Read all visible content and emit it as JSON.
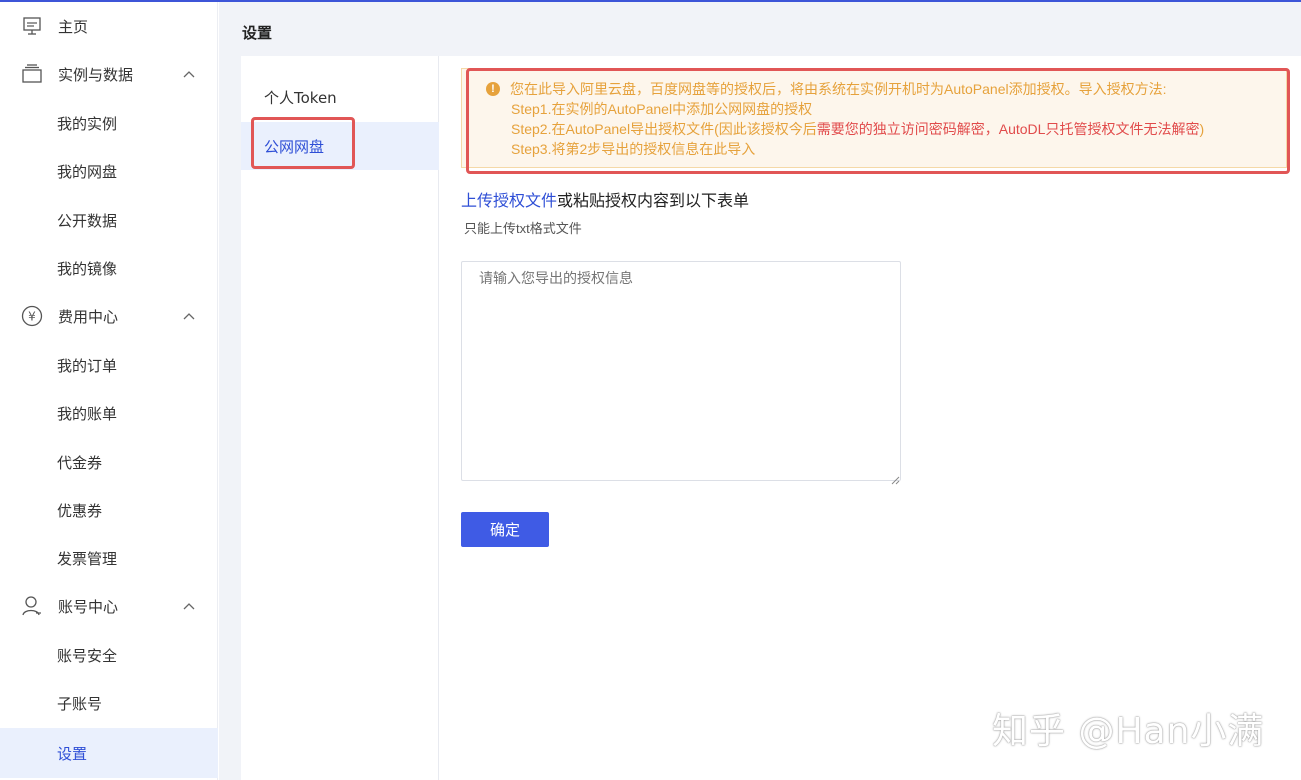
{
  "sidebar": {
    "home": "主页",
    "instances_group": "实例与数据",
    "my_instances": "我的实例",
    "my_netdisk": "我的网盘",
    "public_data": "公开数据",
    "my_images": "我的镜像",
    "billing_group": "费用中心",
    "my_orders": "我的订单",
    "my_bills": "我的账单",
    "vouchers": "代金券",
    "coupons": "优惠券",
    "invoices": "发票管理",
    "account_group": "账号中心",
    "account_security": "账号安全",
    "sub_accounts": "子账号",
    "settings": "设置"
  },
  "page": {
    "title": "设置"
  },
  "tabs": {
    "personal_token": "个人Token",
    "public_netdisk": "公网网盘"
  },
  "alert": {
    "line1": "您在此导入阿里云盘，百度网盘等的授权后，将由系统在实例开机时为AutoPanel添加授权。导入授权方法:",
    "line2": "Step1.在实例的AutoPanel中添加公网网盘的授权",
    "line3_part1": "Step2.在AutoPanel导出授权文件(因此该授权今后",
    "line3_part2": "需要您的独立访问密码解密，AutoDL只托管授权文件无法解密",
    "line3_part3": ")",
    "line4": "Step3.将第2步导出的授权信息在此导入"
  },
  "upload": {
    "link": "上传授权文件",
    "text": "或粘贴授权内容到以下表单",
    "hint": "只能上传txt格式文件"
  },
  "form": {
    "placeholder": "请输入您导出的授权信息",
    "confirm": "确定"
  },
  "watermark": "知乎 @Han小满",
  "colors": {
    "accent": "#3f5be5",
    "warning": "#e6a23c",
    "annotation": "#e15656"
  }
}
